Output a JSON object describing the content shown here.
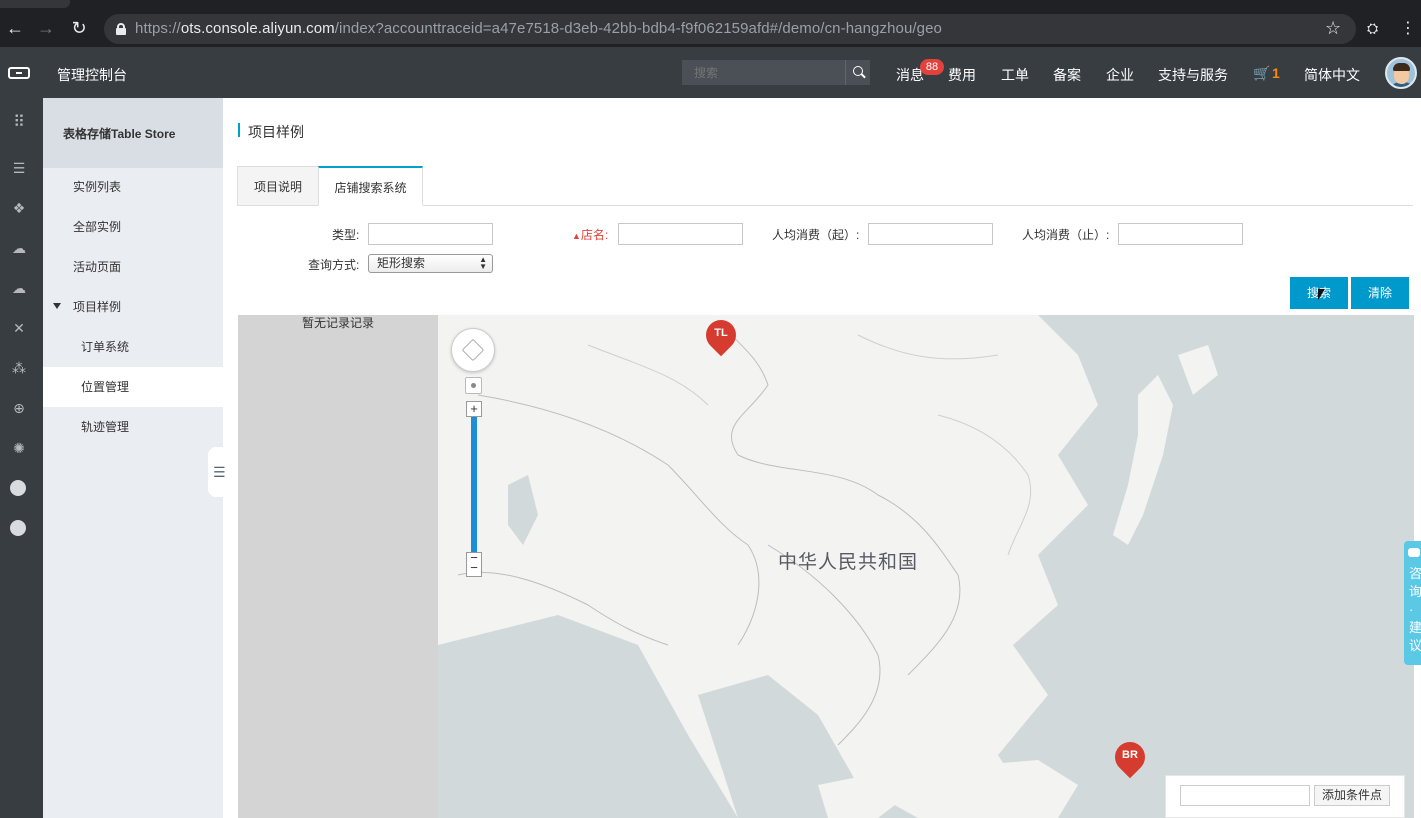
{
  "browser": {
    "url_scheme": "https://",
    "url_host": "ots.console.aliyun.com",
    "url_path": "/index?accounttraceid=a47e7518-d3eb-42bb-bdb4-f9f062159afd#/demo/cn-hangzhou/geo"
  },
  "header": {
    "title": "管理控制台",
    "search_placeholder": "搜索",
    "links": {
      "messages": "消息",
      "messages_badge": "88",
      "billing": "费用",
      "tickets": "工单",
      "icp": "备案",
      "enterprise": "企业",
      "support": "支持与服务",
      "cart_count": "1",
      "language": "简体中文"
    }
  },
  "sidebar": {
    "title": "表格存储Table Store",
    "items": [
      {
        "label": "实例列表"
      },
      {
        "label": "全部实例"
      },
      {
        "label": "活动页面"
      },
      {
        "label": "项目样例"
      },
      {
        "label": "订单系统"
      },
      {
        "label": "位置管理"
      },
      {
        "label": "轨迹管理"
      }
    ]
  },
  "main": {
    "page_title": "项目样例",
    "tabs": [
      {
        "label": "项目说明"
      },
      {
        "label": "店铺搜索系统"
      }
    ],
    "form": {
      "type_label": "类型:",
      "store_label": "店名:",
      "avg_from_label": "人均消费（起）:",
      "avg_to_label": "人均消费（止）:",
      "query_mode_label": "查询方式:",
      "query_mode_value": "矩形搜索"
    },
    "buttons": {
      "search": "搜索",
      "clear": "清除"
    },
    "results_empty": "暂无记录记录",
    "map": {
      "country_label": "中华人民共和国",
      "pin_top": "TL",
      "pin_bottom": "BR",
      "add_condition_button": "添加条件点"
    },
    "feedback_tab": "咨询·建议"
  }
}
